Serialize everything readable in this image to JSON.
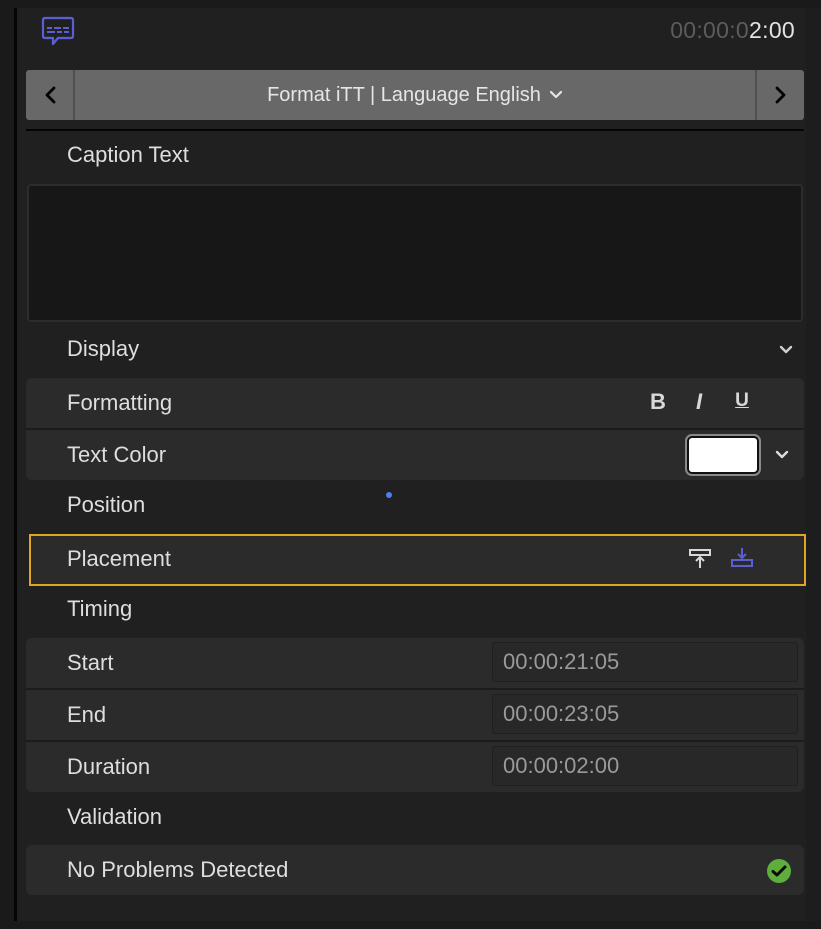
{
  "header": {
    "icon": "caption-bubble-icon",
    "timecode_dim": "00:00:0",
    "timecode_bright": "2:00"
  },
  "navbar": {
    "prev_icon": "chevron-left-icon",
    "next_icon": "chevron-right-icon",
    "title": "Format iTT | Language English",
    "dropdown_icon": "chevron-down-icon"
  },
  "caption_text": {
    "label": "Caption Text",
    "value": ""
  },
  "display": {
    "label": "Display",
    "formatting_label": "Formatting",
    "bold_label": "B",
    "italic_label": "I",
    "underline_label": "U",
    "text_color_label": "Text Color",
    "text_color_value": "#ffffff"
  },
  "position": {
    "label": "Position",
    "placement_label": "Placement",
    "top_icon": "align-top-icon",
    "bottom_icon": "align-bottom-icon",
    "selected": "bottom"
  },
  "timing": {
    "label": "Timing",
    "rows": [
      {
        "label": "Start",
        "value": "00:00:21:05"
      },
      {
        "label": "End",
        "value": "00:00:23:05"
      },
      {
        "label": "Duration",
        "value": "00:00:02:00"
      }
    ]
  },
  "validation": {
    "label": "Validation",
    "status": "No Problems Detected",
    "status_icon": "checkmark-circle-icon"
  },
  "colors": {
    "accent": "#5b5fd6",
    "focus_border": "#e2a521",
    "success": "#5dae3d"
  }
}
